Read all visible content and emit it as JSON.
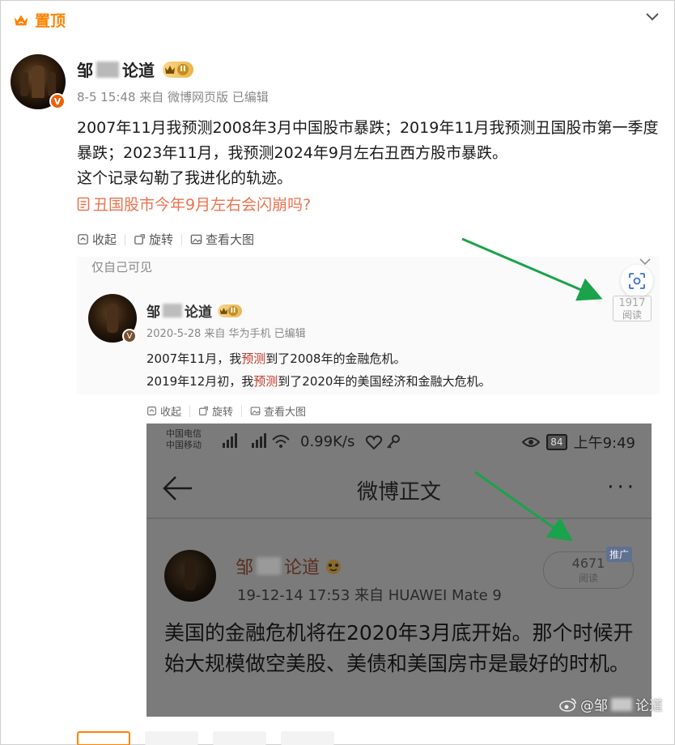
{
  "pin": {
    "label": "置顶"
  },
  "post": {
    "author_prefix": "邹",
    "author_suffix": "论道",
    "vip_level": "II",
    "meta": "8-5 15:48  来自 微博网页版  已编辑",
    "text": "2007年11月我预测2008年3月中国股市暴跌；2019年11月我预测丑国股市第一季度暴跌；2023年11月，我预测2024年9月左右丑西方股市暴跌。\n这个记录勾勒了我进化的轨迹。",
    "topic": "丑国股市今年9月左右会闪崩吗?"
  },
  "toolbar1": {
    "collapse": "收起",
    "rotate": "旋转",
    "view_large": "查看大图"
  },
  "shot1": {
    "visibility": "仅自己可见",
    "read_count": "1917",
    "read_label": "阅读",
    "author_prefix": "邹",
    "author_suffix": "论道",
    "vip_level": "II",
    "meta": "2020-5-28  来自 华为手机  已编辑",
    "line1_pre": "2007年11月，我",
    "line1_hl": "预测",
    "line1_post": "到了2008年的金融危机。",
    "line2_pre": "2019年12月初，我",
    "line2_hl": "预测",
    "line2_post": "到了2020年的美国经济和金融大危机。"
  },
  "toolbar2": {
    "collapse": "收起",
    "rotate": "旋转",
    "view_large": "查看大图"
  },
  "phone": {
    "carrier1": "中国电信",
    "carrier2": "中国移动",
    "signal": "4G 20",
    "speed": "0.99K/s",
    "battery": "84",
    "time": "上午9:49",
    "nav_title": "微博正文",
    "nav_more": "···",
    "author_prefix": "邹",
    "author_suffix": "论道",
    "meta": "19-12-14 17:53   来自 HUAWEI Mate 9",
    "read_count": "4671",
    "read_label": "阅读",
    "promo": "推广",
    "text": "美国的金融危机将在2020年3月底开始。那个时候开始大规模做空美股、美债和美国房市是最好的时机。"
  },
  "watermark": {
    "prefix": "@邹",
    "suffix": "论道"
  },
  "colors": {
    "accent": "#ff8200",
    "topic": "#eb7350",
    "arrow": "#1aa34a",
    "highlight": "#c0392b"
  }
}
